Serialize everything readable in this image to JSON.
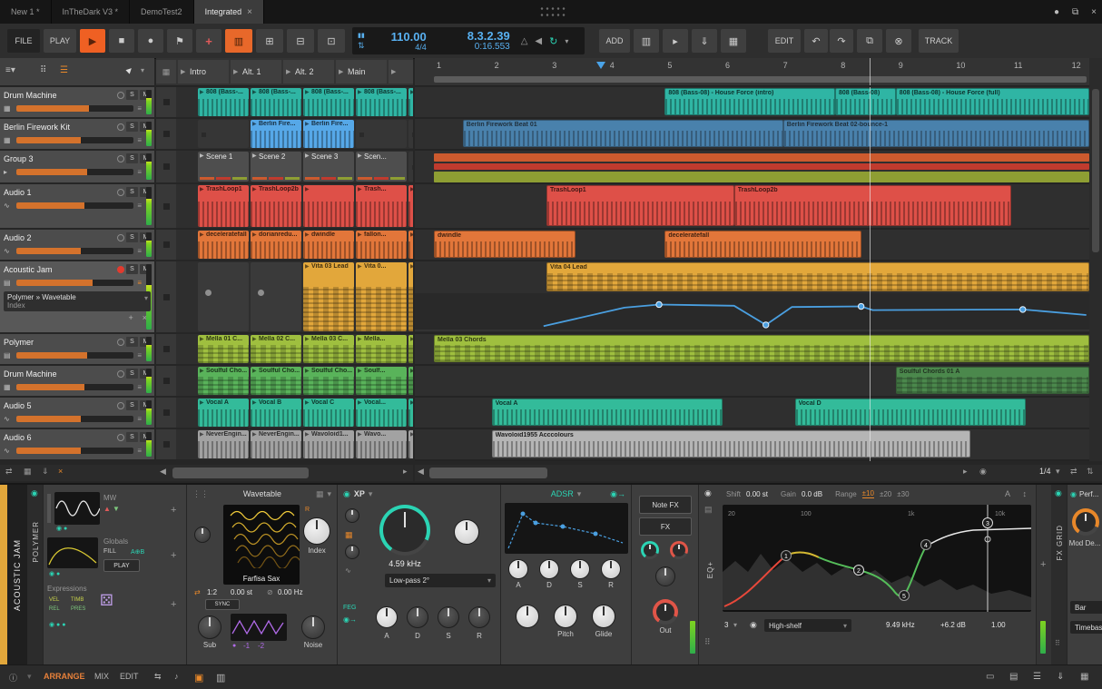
{
  "titlebar": {
    "tabs": [
      {
        "label": "New 1 *",
        "active": false
      },
      {
        "label": "InTheDark V3 *",
        "active": false
      },
      {
        "label": "DemoTest2",
        "active": false
      },
      {
        "label": "Integrated",
        "active": true
      }
    ],
    "close_tab": "×"
  },
  "toolbar": {
    "file": "FILE",
    "play": "PLAY",
    "tempo": "110.00",
    "time_sig": "4/4",
    "position": "8.3.2.39",
    "time": "0:16.553",
    "add": "ADD",
    "edit": "EDIT",
    "track": "TRACK"
  },
  "ui": {
    "solo": "S",
    "mute": "M",
    "plus": "+",
    "close": "×",
    "sync": "SYNC",
    "snap": "1/4"
  },
  "launcher": {
    "scene_headers": [
      "Intro",
      "Alt. 1",
      "Alt. 2",
      "Main",
      ""
    ],
    "rows": [
      {
        "cells": [
          {
            "l": "808 (Bass-...",
            "k": "wave"
          },
          {
            "l": "808 (Bass-...",
            "k": "wave"
          },
          {
            "l": "808 (Bass-...",
            "k": "wave"
          },
          {
            "l": "808 (Bass-...",
            "k": "wave"
          },
          {
            "l": "",
            "k": "wave"
          }
        ]
      },
      {
        "cells": [
          null,
          {
            "l": "Berlin Fire...",
            "k": "wave"
          },
          {
            "l": "Berlin Fire...",
            "k": "wave"
          },
          null,
          null
        ]
      },
      {
        "cells": [
          {
            "l": "Scene 1",
            "k": "scene"
          },
          {
            "l": "Scene 2",
            "k": "scene"
          },
          {
            "l": "Scene 3",
            "k": "scene"
          },
          {
            "l": "Scen...",
            "k": "scene"
          },
          null
        ]
      },
      {
        "cells": [
          {
            "l": "TrashLoop1",
            "k": "wave"
          },
          {
            "l": "TrashLoop2b",
            "k": "wave"
          },
          {
            "l": "",
            "k": "wave"
          },
          {
            "l": "Trash...",
            "k": "wave"
          },
          {
            "l": "",
            "k": "wave"
          }
        ]
      },
      {
        "cells": [
          {
            "l": "deceleratefall",
            "k": "wave"
          },
          {
            "l": "dorianredu...",
            "k": "wave"
          },
          {
            "l": "dwindle",
            "k": "wave"
          },
          {
            "l": "fallon...",
            "k": "wave"
          },
          {
            "l": "",
            "k": "wave"
          }
        ]
      },
      {
        "cells": [
          {
            "l": "",
            "k": "dot"
          },
          {
            "l": "",
            "k": "dot"
          },
          {
            "l": "Vita 03 Lead",
            "k": "midi"
          },
          {
            "l": "Vita 0...",
            "k": "midi"
          },
          {
            "l": "",
            "k": "midi"
          }
        ]
      },
      {
        "cells": [
          {
            "l": "Mella 01 C...",
            "k": "midi"
          },
          {
            "l": "Mella 02 C...",
            "k": "midi"
          },
          {
            "l": "Mella 03 C...",
            "k": "midi"
          },
          {
            "l": "Mella...",
            "k": "midi"
          },
          {
            "l": "",
            "k": "midi"
          }
        ]
      },
      {
        "cells": [
          {
            "l": "Soulful Cho...",
            "k": "midi"
          },
          {
            "l": "Soulful Cho...",
            "k": "midi"
          },
          {
            "l": "Soulful Cho...",
            "k": "midi"
          },
          {
            "l": "Soulf...",
            "k": "midi"
          },
          {
            "l": "",
            "k": "midi"
          }
        ]
      },
      {
        "cells": [
          {
            "l": "Vocal A",
            "k": "wave"
          },
          {
            "l": "Vocal B",
            "k": "wave"
          },
          {
            "l": "Vocal C",
            "k": "wave"
          },
          {
            "l": "Vocal...",
            "k": "wave"
          },
          {
            "l": "",
            "k": "wave"
          }
        ]
      },
      {
        "cells": [
          {
            "l": "NeverEngin...",
            "k": "wave"
          },
          {
            "l": "NeverEngin...",
            "k": "wave"
          },
          {
            "l": "Wavoloid1...",
            "k": "wave"
          },
          {
            "l": "Wavo...",
            "k": "wave"
          },
          {
            "l": "",
            "k": "wave"
          }
        ]
      }
    ]
  },
  "tracks": [
    {
      "name": "Drum Machine",
      "color": "#2fb5a4",
      "icon": "drum-icon",
      "fader": 0.62
    },
    {
      "name": "Berlin Firework Kit",
      "color": "#56a8e8",
      "icon": "drum-icon",
      "fader": 0.55
    },
    {
      "name": "Group 3",
      "color": "#b08d3f",
      "icon": "group-icon",
      "fader": 0.6
    },
    {
      "name": "Audio 1",
      "color": "#de5048",
      "icon": "audio-icon",
      "fader": 0.58
    },
    {
      "name": "Audio 2",
      "color": "#e2763a",
      "icon": "audio-icon",
      "fader": 0.55
    },
    {
      "name": "Acoustic Jam",
      "color": "#e2a73b",
      "icon": "keys-icon",
      "fader": 0.65,
      "selected": true,
      "armed": true,
      "device_chain": "Polymer » Wavetable",
      "device_param": "Index"
    },
    {
      "name": "Polymer",
      "color": "#9fbf3f",
      "icon": "keys-icon",
      "fader": 0.6
    },
    {
      "name": "Drum Machine",
      "color": "#59b35a",
      "icon": "drum-icon",
      "fader": 0.58
    },
    {
      "name": "Audio 5",
      "color": "#33bb9a",
      "icon": "audio-icon",
      "fader": 0.55
    },
    {
      "name": "Audio 6",
      "color": "#a2a2a2",
      "icon": "audio-icon",
      "fader": 0.55
    }
  ],
  "ruler": {
    "beats": [
      "1",
      "2",
      "3",
      "4",
      "5",
      "6",
      "7",
      "8",
      "9",
      "10",
      "11",
      "12"
    ]
  },
  "arranger": {
    "playhead_beat": 8.55,
    "marker_beat": 3.9,
    "group_lane_colors": [
      "#cc5a2e",
      "#c03b2e",
      "#8e9e33"
    ],
    "rows": [
      {
        "clips": [
          {
            "label": "808 (Bass-08) - House Force (intro)",
            "start": 5.0,
            "end": 7.95,
            "k": "wave"
          },
          {
            "label": "808 (Bass-08)",
            "start": 7.95,
            "end": 9.0,
            "k": "wave"
          },
          {
            "label": "808 (Bass-08) - House Force (full)",
            "start": 9.0,
            "end": 12.35,
            "k": "wave"
          }
        ]
      },
      {
        "clips": [
          {
            "label": "Berlin Firework Beat 01",
            "start": 1.5,
            "end": 7.05,
            "k": "wave",
            "dim": true
          },
          {
            "label": "Berlin Firework Beat 02-bounce-1",
            "start": 7.05,
            "end": 12.35,
            "k": "wave",
            "dim": true
          }
        ]
      },
      {
        "group": true,
        "start": 1.0,
        "end": 12.35
      },
      {
        "clips": [
          {
            "label": "TrashLoop1",
            "start": 2.95,
            "end": 6.2,
            "k": "wave"
          },
          {
            "label": "TrashLoop2b",
            "start": 6.2,
            "end": 11.0,
            "k": "wave"
          }
        ]
      },
      {
        "clips": [
          {
            "label": "dwindle",
            "start": 1.0,
            "end": 3.45,
            "k": "wave"
          },
          {
            "label": "deceleratefall",
            "start": 5.0,
            "end": 8.4,
            "k": "wave"
          }
        ]
      },
      {
        "clips": [
          {
            "label": "Vita 04 Lead",
            "start": 2.95,
            "end": 12.35,
            "k": "midi"
          }
        ],
        "automation": true
      },
      {
        "clips": [
          {
            "label": "Mella 03 Chords",
            "start": 1.0,
            "end": 12.35,
            "k": "midi"
          }
        ]
      },
      {
        "clips": [
          {
            "label": "Soulful Chords 01 A",
            "start": 9.0,
            "end": 12.35,
            "k": "midi",
            "dim": true
          }
        ]
      },
      {
        "clips": [
          {
            "label": "Vocal A",
            "start": 2.0,
            "end": 6.0,
            "k": "wave"
          },
          {
            "label": "Vocal D",
            "start": 7.25,
            "end": 11.25,
            "k": "wave"
          }
        ]
      },
      {
        "clips": [
          {
            "label": "Wavoloid1955 Acccolours",
            "start": 2.0,
            "end": 10.3,
            "k": "wave",
            "gray": true
          }
        ]
      }
    ],
    "automation": {
      "points": [
        {
          "b": 2.9,
          "v": 0.08
        },
        {
          "b": 4.3,
          "v": 0.68
        },
        {
          "b": 4.9,
          "v": 0.78,
          "node": true
        },
        {
          "b": 6.2,
          "v": 0.74
        },
        {
          "b": 6.75,
          "v": 0.12,
          "node": true
        },
        {
          "b": 7.2,
          "v": 0.7
        },
        {
          "b": 8.4,
          "v": 0.72,
          "node": true
        },
        {
          "b": 8.6,
          "v": 0.6
        },
        {
          "b": 11.2,
          "v": 0.62,
          "node": true
        },
        {
          "b": 12.3,
          "v": 0.44
        }
      ]
    }
  },
  "device_panel": {
    "track_name": "ACOUSTIC JAM",
    "polymer": {
      "name": "POLYMER",
      "mw": "MW",
      "globals": "Globals",
      "fill": "FILL",
      "ab": "A⊕B",
      "play": "PLAY",
      "expressions": "Expressions",
      "exp_labels": [
        "VEL",
        "TIMB",
        "REL",
        "PRES"
      ]
    },
    "wavetable": {
      "title": "Wavetable",
      "preset": "Farfisa Sax",
      "index": "Index",
      "ratio": "1:2",
      "detune": "0.00 st",
      "freq": "0.00 Hz",
      "sub": "Sub",
      "noise": "Noise",
      "lfo_vals": [
        "-1",
        "-2"
      ]
    },
    "xp": {
      "title": "XP",
      "cutoff": "4.59 kHz",
      "mode": "Low-pass 2°",
      "feg": "FEG",
      "env_labels": [
        "A",
        "D",
        "S",
        "R"
      ]
    },
    "adsr": {
      "title": "ADSR",
      "labels": [
        "A",
        "D",
        "S",
        "R"
      ],
      "pitch": "Pitch",
      "glide": "Glide"
    },
    "note_fx": "Note FX",
    "fx": "FX",
    "out": "Out",
    "eq": {
      "shift_label": "Shift",
      "shift": "0.00 st",
      "gain_label": "Gain",
      "gain": "0.0 dB",
      "range_label": "Range",
      "ranges": [
        "±10",
        "±20",
        "±30"
      ],
      "freqs": [
        "20",
        "100",
        "1k",
        "10k"
      ],
      "nodes": [
        "1",
        "2",
        "3",
        "4",
        "5"
      ],
      "band": "3",
      "type": "High-shelf",
      "freq_val": "9.49 kHz",
      "gain_val": "+6.2 dB",
      "q_val": "1.00"
    },
    "fx_grid": "FX GRID",
    "partial": {
      "title": "Perf...",
      "knob_label": "Mod De...",
      "bar": "Bar",
      "timebase": "Timebas..."
    }
  },
  "footer": {
    "arrange": "ARRANGE",
    "mix": "MIX",
    "edit": "EDIT"
  }
}
